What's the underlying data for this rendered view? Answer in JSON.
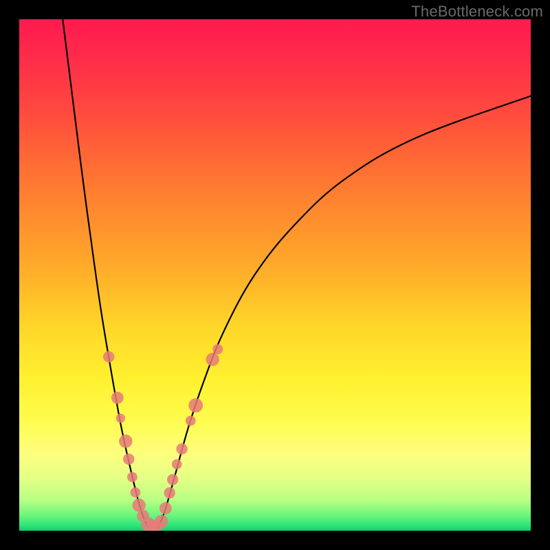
{
  "watermark": "TheBottleneck.com",
  "colors": {
    "frame": "#000000",
    "curve": "#000000",
    "dot": "#e77a78",
    "gradient_top": "#ff1a4f",
    "gradient_bottom": "#16c86f"
  },
  "chart_data": {
    "type": "line",
    "title": "",
    "xlabel": "",
    "ylabel": "",
    "xlim": [
      0,
      100
    ],
    "ylim": [
      0,
      100
    ],
    "grid": false,
    "legend": false,
    "notes": "V-shaped bottleneck curve on a vertical red→green gradient. x is an unlabeled horizontal parameter (0–100 of plot width), y is percent bottleneck (0 at bottom/green, 100 at top/red). Two monotone branches meet near x≈25 at y≈0. Values estimated from pixel positions.",
    "series": [
      {
        "name": "left-branch",
        "x": [
          8.5,
          10,
          12,
          14,
          16,
          18,
          20,
          22,
          23.8,
          25.2
        ],
        "y": [
          100,
          88,
          72,
          57,
          43,
          31,
          20,
          11,
          4,
          0.6
        ]
      },
      {
        "name": "right-branch",
        "x": [
          27.2,
          28.5,
          30.5,
          33,
          36,
          40,
          46,
          54,
          64,
          78,
          100
        ],
        "y": [
          0.6,
          4,
          11,
          20,
          29,
          39,
          50,
          60,
          69,
          77,
          85
        ]
      }
    ],
    "markers": [
      {
        "branch": "left",
        "x": 17.5,
        "y": 34.0,
        "r": 1.1
      },
      {
        "branch": "left",
        "x": 19.2,
        "y": 26.0,
        "r": 1.2
      },
      {
        "branch": "left",
        "x": 19.8,
        "y": 22.0,
        "r": 0.9
      },
      {
        "branch": "left",
        "x": 20.8,
        "y": 17.5,
        "r": 1.3
      },
      {
        "branch": "left",
        "x": 21.4,
        "y": 14.0,
        "r": 1.1
      },
      {
        "branch": "left",
        "x": 22.1,
        "y": 10.5,
        "r": 1.0
      },
      {
        "branch": "left",
        "x": 22.7,
        "y": 7.5,
        "r": 1.0
      },
      {
        "branch": "left",
        "x": 23.4,
        "y": 5.0,
        "r": 1.3
      },
      {
        "branch": "left",
        "x": 24.2,
        "y": 2.9,
        "r": 1.2
      },
      {
        "branch": "left",
        "x": 25.2,
        "y": 1.2,
        "r": 1.4
      },
      {
        "branch": "floor",
        "x": 26.0,
        "y": 0.8,
        "r": 1.3
      },
      {
        "branch": "floor",
        "x": 26.8,
        "y": 0.8,
        "r": 1.2
      },
      {
        "branch": "right",
        "x": 27.8,
        "y": 1.8,
        "r": 1.3
      },
      {
        "branch": "right",
        "x": 28.6,
        "y": 4.4,
        "r": 1.2
      },
      {
        "branch": "right",
        "x": 29.4,
        "y": 7.4,
        "r": 1.1
      },
      {
        "branch": "right",
        "x": 30.0,
        "y": 10.0,
        "r": 1.1
      },
      {
        "branch": "right",
        "x": 30.8,
        "y": 13.0,
        "r": 1.0
      },
      {
        "branch": "right",
        "x": 31.8,
        "y": 16.0,
        "r": 1.1
      },
      {
        "branch": "right",
        "x": 33.5,
        "y": 21.5,
        "r": 1.0
      },
      {
        "branch": "right",
        "x": 34.5,
        "y": 24.5,
        "r": 1.4
      },
      {
        "branch": "right",
        "x": 37.8,
        "y": 33.5,
        "r": 1.3
      },
      {
        "branch": "right",
        "x": 38.8,
        "y": 35.5,
        "r": 1.0
      }
    ]
  }
}
